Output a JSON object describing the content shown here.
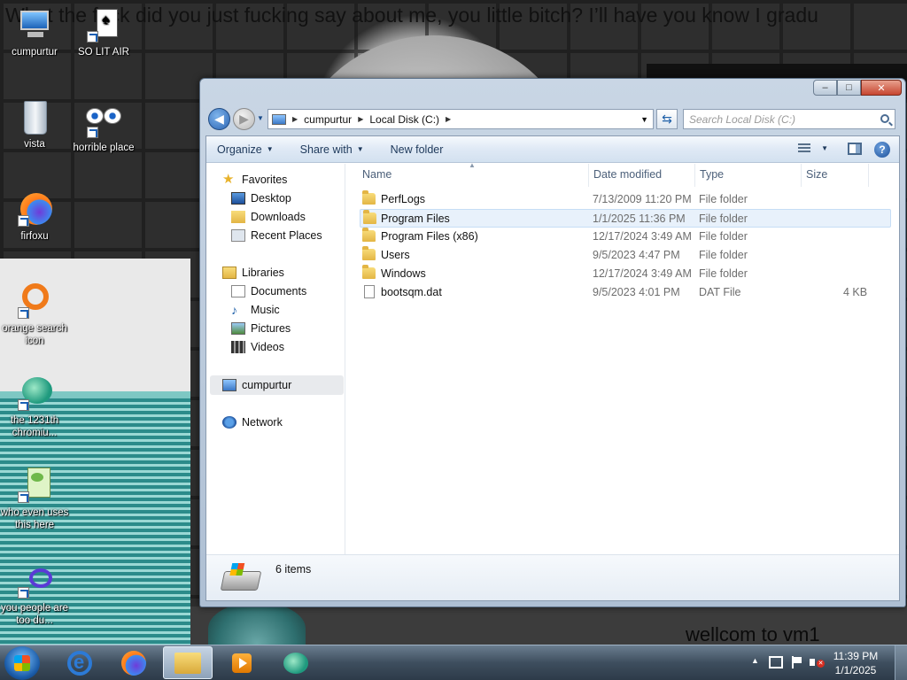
{
  "desktop": {
    "banner_text": "What the fuck did you just fucking say about me, you little bitch? I’ll have you know I gradu",
    "wellcome_text": "wellcom to vm1",
    "icons": [
      {
        "label": "cumpurtur",
        "icon": "computer-icon"
      },
      {
        "label": "SO LIT AIR",
        "icon": "solitaire-icon"
      },
      {
        "label": "vista",
        "icon": "recycle-bin-icon"
      },
      {
        "label": "horrible place",
        "icon": "eyes-icon"
      },
      {
        "label": "firfoxu",
        "icon": "firefox-icon"
      },
      {
        "label": "orange search icon",
        "icon": "orange-search-icon"
      },
      {
        "label": "the 1231th chromiu...",
        "icon": "chromium-icon"
      },
      {
        "label": "who even uses this here",
        "icon": "notepad-icon"
      },
      {
        "label": "you people are too du...",
        "icon": "edge-icon"
      }
    ]
  },
  "window": {
    "title_buttons": {
      "minimize": "–",
      "maximize": "□",
      "close": "✕"
    },
    "address": {
      "crumbs": [
        "cumpurtur",
        "Local Disk (C:)"
      ]
    },
    "search": {
      "placeholder": "Search Local Disk (C:)"
    },
    "toolbar": {
      "organize": "Organize",
      "share_with": "Share with",
      "new_folder": "New folder",
      "help": "?"
    },
    "nav": {
      "favorites": "Favorites",
      "desktop": "Desktop",
      "downloads": "Downloads",
      "recent_places": "Recent Places",
      "libraries": "Libraries",
      "documents": "Documents",
      "music": "Music",
      "pictures": "Pictures",
      "videos": "Videos",
      "computer": "cumpurtur",
      "network": "Network"
    },
    "columns": {
      "name": "Name",
      "date_modified": "Date modified",
      "type": "Type",
      "size": "Size"
    },
    "files": [
      {
        "name": "PerfLogs",
        "date": "7/13/2009 11:20 PM",
        "type": "File folder",
        "size": "",
        "kind": "folder"
      },
      {
        "name": "Program Files",
        "date": "1/1/2025 11:36 PM",
        "type": "File folder",
        "size": "",
        "kind": "folder"
      },
      {
        "name": "Program Files (x86)",
        "date": "12/17/2024 3:49 AM",
        "type": "File folder",
        "size": "",
        "kind": "folder"
      },
      {
        "name": "Users",
        "date": "9/5/2023 4:47 PM",
        "type": "File folder",
        "size": "",
        "kind": "folder"
      },
      {
        "name": "Windows",
        "date": "12/17/2024 3:49 AM",
        "type": "File folder",
        "size": "",
        "kind": "folder"
      },
      {
        "name": "bootsqm.dat",
        "date": "9/5/2023 4:01 PM",
        "type": "DAT File",
        "size": "4 KB",
        "kind": "file"
      }
    ],
    "status": {
      "item_count": "6 items"
    }
  },
  "taskbar": {
    "clock_time": "11:39 PM",
    "clock_date": "1/1/2025",
    "tray_arrow": "▲"
  }
}
